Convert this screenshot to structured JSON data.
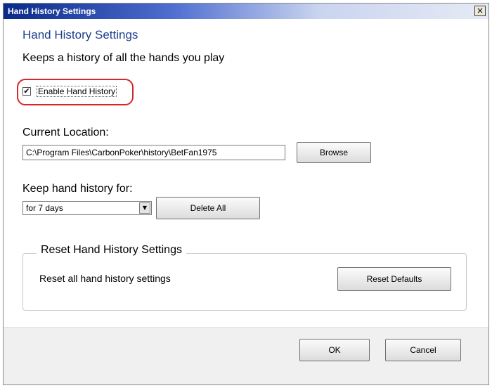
{
  "window": {
    "title": "Hand History Settings",
    "close_glyph": "×"
  },
  "main": {
    "heading": "Hand History Settings",
    "subtitle": "Keeps a history of all the hands you play",
    "enable_checkbox": {
      "label": "Enable Hand History",
      "checked": true,
      "check_glyph": "✔"
    },
    "location": {
      "label": "Current Location:",
      "value": "C:\\Program Files\\CarbonPoker\\history\\BetFan1975",
      "browse_label": "Browse"
    },
    "keep_history": {
      "label": "Keep hand history for:",
      "selected": "for 7 days",
      "arrow_glyph": "▼",
      "delete_all_label": "Delete All"
    },
    "reset_group": {
      "title": "Reset Hand History Settings",
      "description": "Reset all hand history settings",
      "reset_button_label": "Reset Defaults"
    }
  },
  "footer": {
    "ok_label": "OK",
    "cancel_label": "Cancel"
  },
  "colors": {
    "heading": "#1e3f8f",
    "highlight_oval": "#d8262a",
    "title_bar_start": "#0a2a8a"
  },
  "icons": {
    "close": "close-icon",
    "dropdown": "chevron-down-icon",
    "check": "checkmark-icon"
  }
}
